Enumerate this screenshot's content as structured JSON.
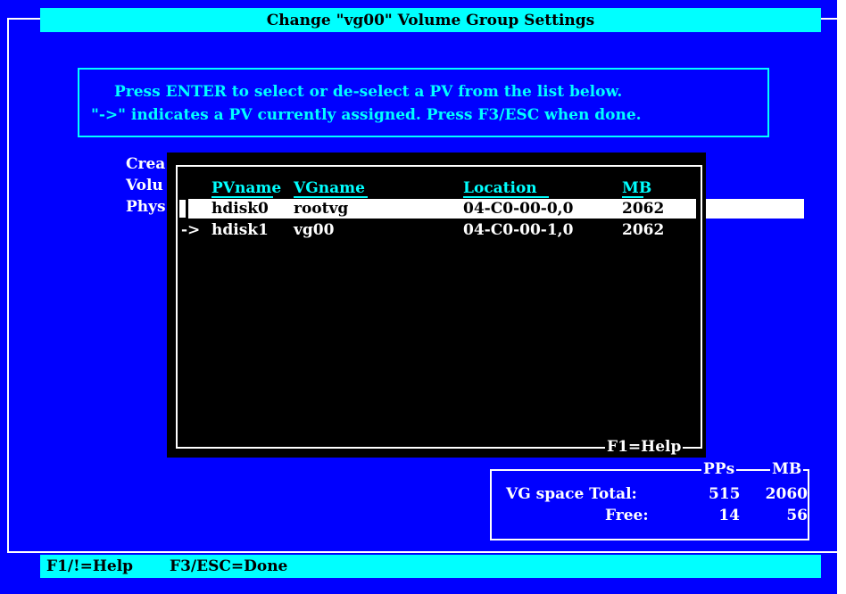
{
  "window": {
    "title": "Change \"vg00\" Volume Group Settings"
  },
  "instructions": {
    "line1": "Press ENTER to select or de-select a PV from the list below.",
    "line2": "\"->\" indicates a PV currently assigned. Press F3/ESC when done."
  },
  "background_fields": {
    "line1": "Crea",
    "line2": "Volu",
    "line3": "Phys"
  },
  "pv_list": {
    "columns": [
      "PVname",
      "VGname",
      "Location",
      "MB"
    ],
    "rows": [
      {
        "marker": "",
        "pvname": "hdisk0",
        "vgname": "rootvg",
        "location": "04-C0-00-0,0",
        "mb": "2062",
        "selected": true
      },
      {
        "marker": "->",
        "pvname": "hdisk1",
        "vgname": "vg00",
        "location": "04-C0-00-1,0",
        "mb": "2062",
        "selected": false
      }
    ],
    "help_label": "F1=Help"
  },
  "vg_space": {
    "col_pps": "PPs",
    "col_mb": "MB",
    "total_label": "VG space Total:",
    "total_pps": "515",
    "total_mb": "2060",
    "free_label": "Free:",
    "free_pps": "14",
    "free_mb": "56"
  },
  "footer": {
    "help": "F1/!=Help",
    "done": "F3/ESC=Done"
  },
  "colors": {
    "background": "#0000ff",
    "accent": "#00ffff",
    "dialog": "#000000",
    "text": "#ffffff"
  }
}
